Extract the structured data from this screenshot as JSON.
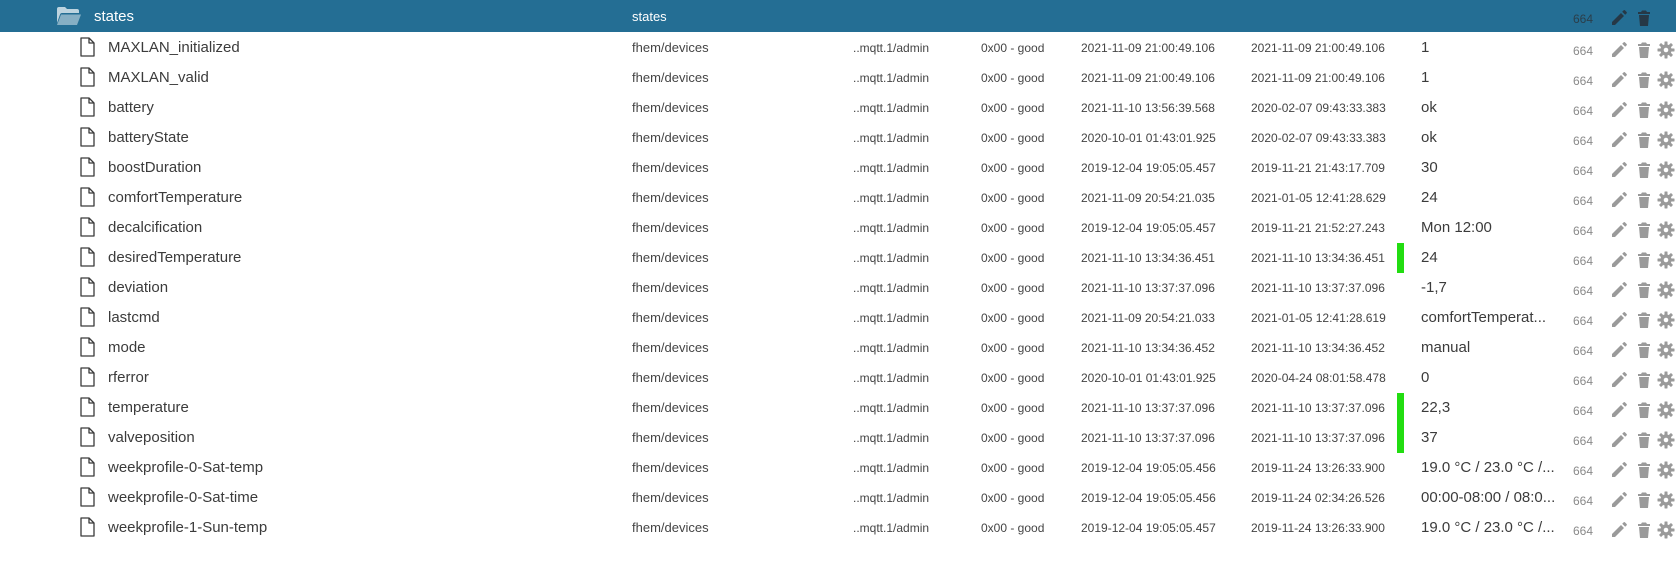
{
  "header": {
    "name": "states",
    "role": "states",
    "acl": "664"
  },
  "colors": {
    "header_bg": "#246e94",
    "ack_bar": "#22dd11",
    "icon_gray": "#9a9a9a"
  },
  "icons": {
    "folder": "folder-open-icon",
    "file": "file-icon",
    "edit": "pencil-icon",
    "delete": "trash-icon",
    "settings": "gear-icon"
  },
  "rows": [
    {
      "name": "MAXLAN_initialized",
      "role": "fhem/devices",
      "from": "..mqtt.1/admin",
      "quality": "0x00 - good",
      "ts": "2021-11-09 21:00:49.106",
      "lc": "2021-11-09 21:00:49.106",
      "value": "1",
      "acl": "664",
      "ack": false
    },
    {
      "name": "MAXLAN_valid",
      "role": "fhem/devices",
      "from": "..mqtt.1/admin",
      "quality": "0x00 - good",
      "ts": "2021-11-09 21:00:49.106",
      "lc": "2021-11-09 21:00:49.106",
      "value": "1",
      "acl": "664",
      "ack": false
    },
    {
      "name": "battery",
      "role": "fhem/devices",
      "from": "..mqtt.1/admin",
      "quality": "0x00 - good",
      "ts": "2021-11-10 13:56:39.568",
      "lc": "2020-02-07 09:43:33.383",
      "value": "ok",
      "acl": "664",
      "ack": false
    },
    {
      "name": "batteryState",
      "role": "fhem/devices",
      "from": "..mqtt.1/admin",
      "quality": "0x00 - good",
      "ts": "2020-10-01 01:43:01.925",
      "lc": "2020-02-07 09:43:33.383",
      "value": "ok",
      "acl": "664",
      "ack": false
    },
    {
      "name": "boostDuration",
      "role": "fhem/devices",
      "from": "..mqtt.1/admin",
      "quality": "0x00 - good",
      "ts": "2019-12-04 19:05:05.457",
      "lc": "2019-11-21 21:43:17.709",
      "value": "30",
      "acl": "664",
      "ack": false
    },
    {
      "name": "comfortTemperature",
      "role": "fhem/devices",
      "from": "..mqtt.1/admin",
      "quality": "0x00 - good",
      "ts": "2021-11-09 20:54:21.035",
      "lc": "2021-01-05 12:41:28.629",
      "value": "24",
      "acl": "664",
      "ack": false
    },
    {
      "name": "decalcification",
      "role": "fhem/devices",
      "from": "..mqtt.1/admin",
      "quality": "0x00 - good",
      "ts": "2019-12-04 19:05:05.457",
      "lc": "2019-11-21 21:52:27.243",
      "value": "Mon 12:00",
      "acl": "664",
      "ack": false
    },
    {
      "name": "desiredTemperature",
      "role": "fhem/devices",
      "from": "..mqtt.1/admin",
      "quality": "0x00 - good",
      "ts": "2021-11-10 13:34:36.451",
      "lc": "2021-11-10 13:34:36.451",
      "value": "24",
      "acl": "664",
      "ack": true
    },
    {
      "name": "deviation",
      "role": "fhem/devices",
      "from": "..mqtt.1/admin",
      "quality": "0x00 - good",
      "ts": "2021-11-10 13:37:37.096",
      "lc": "2021-11-10 13:37:37.096",
      "value": "-1,7",
      "acl": "664",
      "ack": false
    },
    {
      "name": "lastcmd",
      "role": "fhem/devices",
      "from": "..mqtt.1/admin",
      "quality": "0x00 - good",
      "ts": "2021-11-09 20:54:21.033",
      "lc": "2021-01-05 12:41:28.619",
      "value": "comfortTemperat...",
      "acl": "664",
      "ack": false
    },
    {
      "name": "mode",
      "role": "fhem/devices",
      "from": "..mqtt.1/admin",
      "quality": "0x00 - good",
      "ts": "2021-11-10 13:34:36.452",
      "lc": "2021-11-10 13:34:36.452",
      "value": "manual",
      "acl": "664",
      "ack": false
    },
    {
      "name": "rferror",
      "role": "fhem/devices",
      "from": "..mqtt.1/admin",
      "quality": "0x00 - good",
      "ts": "2020-10-01 01:43:01.925",
      "lc": "2020-04-24 08:01:58.478",
      "value": "0",
      "acl": "664",
      "ack": false
    },
    {
      "name": "temperature",
      "role": "fhem/devices",
      "from": "..mqtt.1/admin",
      "quality": "0x00 - good",
      "ts": "2021-11-10 13:37:37.096",
      "lc": "2021-11-10 13:37:37.096",
      "value": "22,3",
      "acl": "664",
      "ack": true
    },
    {
      "name": "valveposition",
      "role": "fhem/devices",
      "from": "..mqtt.1/admin",
      "quality": "0x00 - good",
      "ts": "2021-11-10 13:37:37.096",
      "lc": "2021-11-10 13:37:37.096",
      "value": "37",
      "acl": "664",
      "ack": true
    },
    {
      "name": "weekprofile-0-Sat-temp",
      "role": "fhem/devices",
      "from": "..mqtt.1/admin",
      "quality": "0x00 - good",
      "ts": "2019-12-04 19:05:05.456",
      "lc": "2019-11-24 13:26:33.900",
      "value": "19.0 °C / 23.0 °C /...",
      "acl": "664",
      "ack": false
    },
    {
      "name": "weekprofile-0-Sat-time",
      "role": "fhem/devices",
      "from": "..mqtt.1/admin",
      "quality": "0x00 - good",
      "ts": "2019-12-04 19:05:05.456",
      "lc": "2019-11-24 02:34:26.526",
      "value": "00:00-08:00 / 08:0...",
      "acl": "664",
      "ack": false
    },
    {
      "name": "weekprofile-1-Sun-temp",
      "role": "fhem/devices",
      "from": "..mqtt.1/admin",
      "quality": "0x00 - good",
      "ts": "2019-12-04 19:05:05.457",
      "lc": "2019-11-24 13:26:33.900",
      "value": "19.0 °C / 23.0 °C /...",
      "acl": "664",
      "ack": false
    }
  ]
}
